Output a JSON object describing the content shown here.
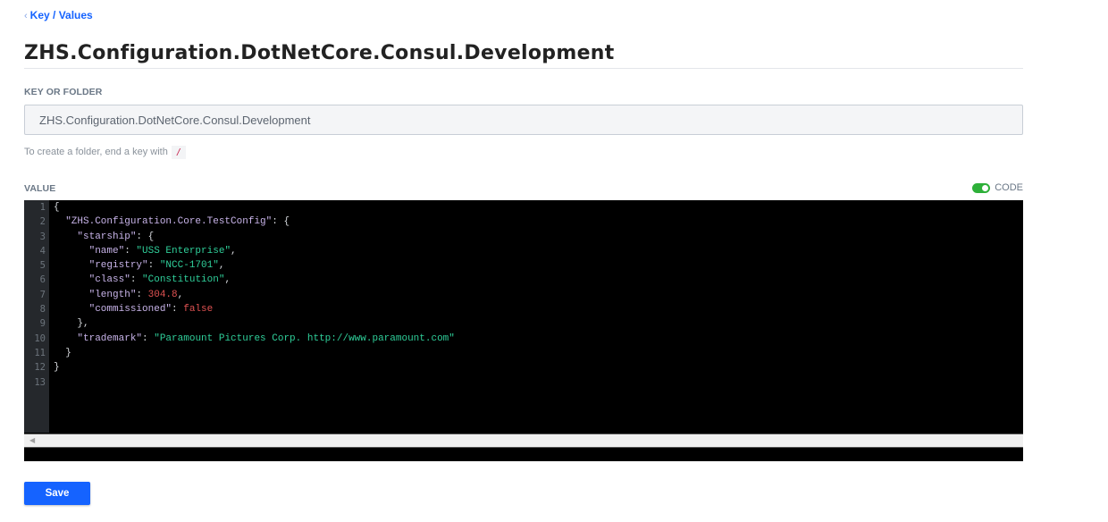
{
  "breadcrumb": {
    "label": "Key / Values"
  },
  "page_title": "ZHS.Configuration.DotNetCore.Consul.Development",
  "key_field": {
    "label": "KEY OR FOLDER",
    "value": "ZHS.Configuration.DotNetCore.Consul.Development",
    "help_text": "To create a folder, end a key with",
    "help_code": "/"
  },
  "value_field": {
    "label": "VALUE",
    "code_toggle_label": "CODE",
    "code_toggle_on": true
  },
  "editor": {
    "line_numbers": [
      "1",
      "2",
      "3",
      "4",
      "5",
      "6",
      "7",
      "8",
      "9",
      "10",
      "11",
      "12",
      "13"
    ],
    "lines": [
      [
        {
          "t": "p",
          "v": "{"
        }
      ],
      [
        {
          "t": "p",
          "v": "  "
        },
        {
          "t": "k",
          "v": "\"ZHS.Configuration.Core.TestConfig\""
        },
        {
          "t": "p",
          "v": ": {"
        }
      ],
      [
        {
          "t": "p",
          "v": "    "
        },
        {
          "t": "k",
          "v": "\"starship\""
        },
        {
          "t": "p",
          "v": ": {"
        }
      ],
      [
        {
          "t": "p",
          "v": "      "
        },
        {
          "t": "k",
          "v": "\"name\""
        },
        {
          "t": "p",
          "v": ": "
        },
        {
          "t": "s",
          "v": "\"USS Enterprise\""
        },
        {
          "t": "p",
          "v": ","
        }
      ],
      [
        {
          "t": "p",
          "v": "      "
        },
        {
          "t": "k",
          "v": "\"registry\""
        },
        {
          "t": "p",
          "v": ": "
        },
        {
          "t": "s",
          "v": "\"NCC-1701\""
        },
        {
          "t": "p",
          "v": ","
        }
      ],
      [
        {
          "t": "p",
          "v": "      "
        },
        {
          "t": "k",
          "v": "\"class\""
        },
        {
          "t": "p",
          "v": ": "
        },
        {
          "t": "s",
          "v": "\"Constitution\""
        },
        {
          "t": "p",
          "v": ","
        }
      ],
      [
        {
          "t": "p",
          "v": "      "
        },
        {
          "t": "k",
          "v": "\"length\""
        },
        {
          "t": "p",
          "v": ": "
        },
        {
          "t": "n",
          "v": "304.8"
        },
        {
          "t": "p",
          "v": ","
        }
      ],
      [
        {
          "t": "p",
          "v": "      "
        },
        {
          "t": "k",
          "v": "\"commissioned\""
        },
        {
          "t": "p",
          "v": ": "
        },
        {
          "t": "n",
          "v": "false"
        }
      ],
      [
        {
          "t": "p",
          "v": "    },"
        }
      ],
      [
        {
          "t": "p",
          "v": "    "
        },
        {
          "t": "k",
          "v": "\"trademark\""
        },
        {
          "t": "p",
          "v": ": "
        },
        {
          "t": "s",
          "v": "\"Paramount Pictures Corp. http://www.paramount.com\""
        }
      ],
      [
        {
          "t": "p",
          "v": "  }"
        }
      ],
      [
        {
          "t": "p",
          "v": "}"
        }
      ],
      []
    ]
  },
  "icons": {
    "back": "chevron-left-icon",
    "scroll_left": "scroll-left-arrow-icon"
  },
  "colors": {
    "accent": "#1563ff",
    "toggle_on": "#2eb039",
    "json_key": "#c7b3e8",
    "json_string": "#2fcf9a",
    "json_literal": "#e05252"
  },
  "actions": {
    "save_label": "Save"
  }
}
